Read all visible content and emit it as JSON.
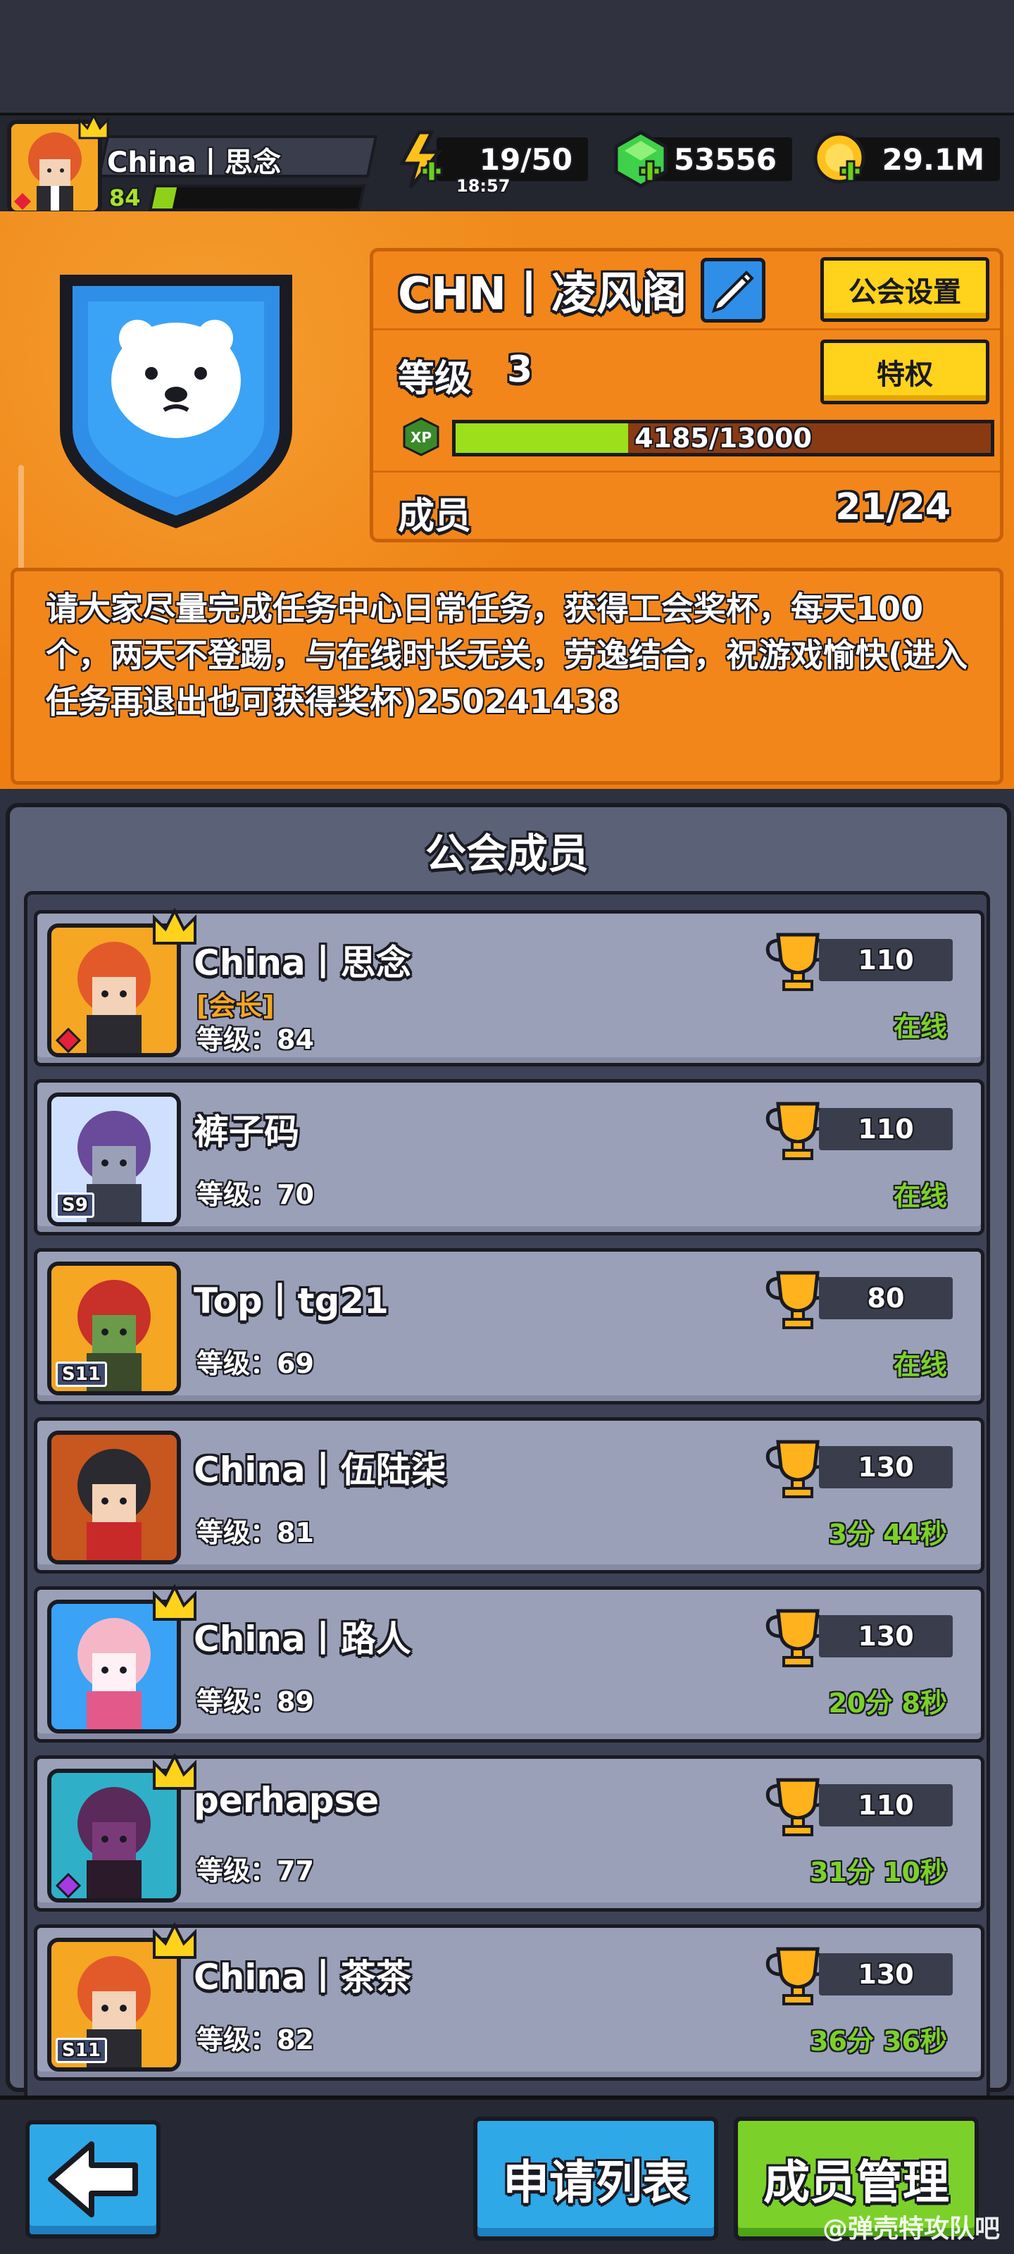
{
  "player": {
    "name": "China丨思念",
    "level": "84",
    "xp_fraction": 0.1
  },
  "resources": {
    "energy": "19/50",
    "energy_timer": "18:57",
    "gems": "53556",
    "coins": "29.1M"
  },
  "guild": {
    "name": "CHN丨凌风阁",
    "settings_label": "公会设置",
    "privilege_label": "特权",
    "level_label": "等级",
    "level_value": "3",
    "xp_icon": "XP",
    "xp_text": "4185/13000",
    "xp_fraction": 0.3219,
    "members_label": "成员",
    "members_value": "21/24",
    "announcement": "请大家尽量完成任务中心日常任务，获得工会奖杯，每天100个，两天不登踢，与在线时长无关，劳逸结合，祝游戏愉快(进入任务再退出也可获得奖杯)250241438"
  },
  "members_panel": {
    "title": "公会成员",
    "members": [
      {
        "name": "China丨思念",
        "role": "[会长]",
        "level": "等级：84",
        "trophies": "110",
        "status": "在线",
        "season": ""
      },
      {
        "name": "裤子码",
        "role": "",
        "level": "等级：70",
        "trophies": "110",
        "status": "在线",
        "season": "S9"
      },
      {
        "name": "Top丨tg21",
        "role": "",
        "level": "等级：69",
        "trophies": "80",
        "status": "在线",
        "season": "S11"
      },
      {
        "name": "China丨伍陆柒",
        "role": "",
        "level": "等级：81",
        "trophies": "130",
        "status": "3分 44秒",
        "season": ""
      },
      {
        "name": "China丨路人",
        "role": "",
        "level": "等级：89",
        "trophies": "130",
        "status": "20分 8秒",
        "season": ""
      },
      {
        "name": "perhapse",
        "role": "",
        "level": "等级：77",
        "trophies": "110",
        "status": "31分 10秒",
        "season": ""
      },
      {
        "name": "China丨茶茶",
        "role": "",
        "level": "等级：82",
        "trophies": "130",
        "status": "36分 36秒",
        "season": "S11"
      }
    ]
  },
  "bottom": {
    "apply_list": "申请列表",
    "member_manage": "成员管理",
    "watermark": "@弹壳特攻队吧"
  },
  "colors": {
    "orange": "#ef7e12",
    "green": "#9be01a",
    "yellow": "#ffd21c",
    "blue": "#2fa8e8",
    "online": "#7bd12a"
  }
}
